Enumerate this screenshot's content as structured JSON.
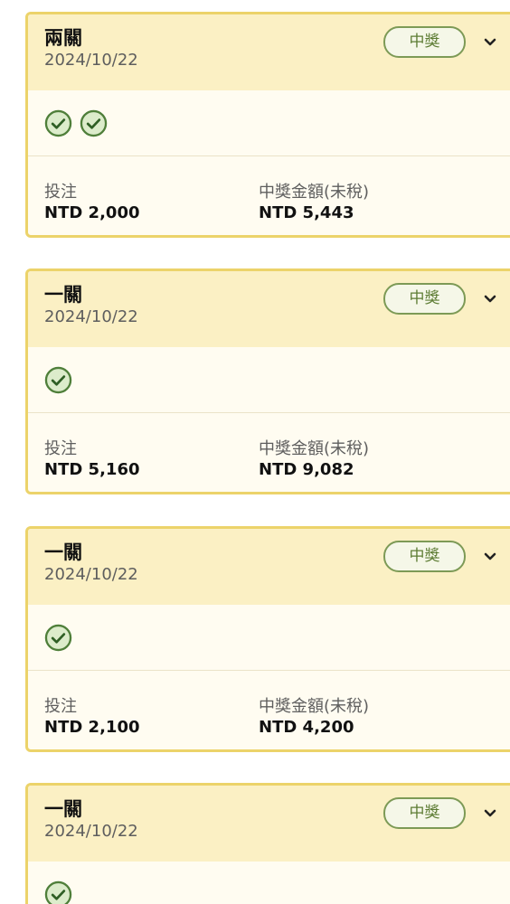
{
  "cards": [
    {
      "title": "兩關",
      "date": "2024/10/22",
      "status": "中獎",
      "checks": 2,
      "bet_label": "投注",
      "bet_value": "NTD 2,000",
      "prize_label": "中獎金額(未稅)",
      "prize_value": "NTD 5,443"
    },
    {
      "title": "一關",
      "date": "2024/10/22",
      "status": "中獎",
      "checks": 1,
      "bet_label": "投注",
      "bet_value": "NTD 5,160",
      "prize_label": "中獎金額(未稅)",
      "prize_value": "NTD 9,082"
    },
    {
      "title": "一關",
      "date": "2024/10/22",
      "status": "中獎",
      "checks": 1,
      "bet_label": "投注",
      "bet_value": "NTD 2,100",
      "prize_label": "中獎金額(未稅)",
      "prize_value": "NTD 4,200"
    },
    {
      "title": "一關",
      "date": "2024/10/22",
      "status": "中獎",
      "checks": 1
    }
  ],
  "icons": {
    "check": "check-circle-icon",
    "expand": "chevron-down-icon"
  },
  "colors": {
    "card_border": "#ecd36a",
    "card_header_bg": "#fbf0c4",
    "card_body_bg": "#fffcf1",
    "badge_green": "#5d7c33",
    "check_green": "#4f7f3a"
  }
}
